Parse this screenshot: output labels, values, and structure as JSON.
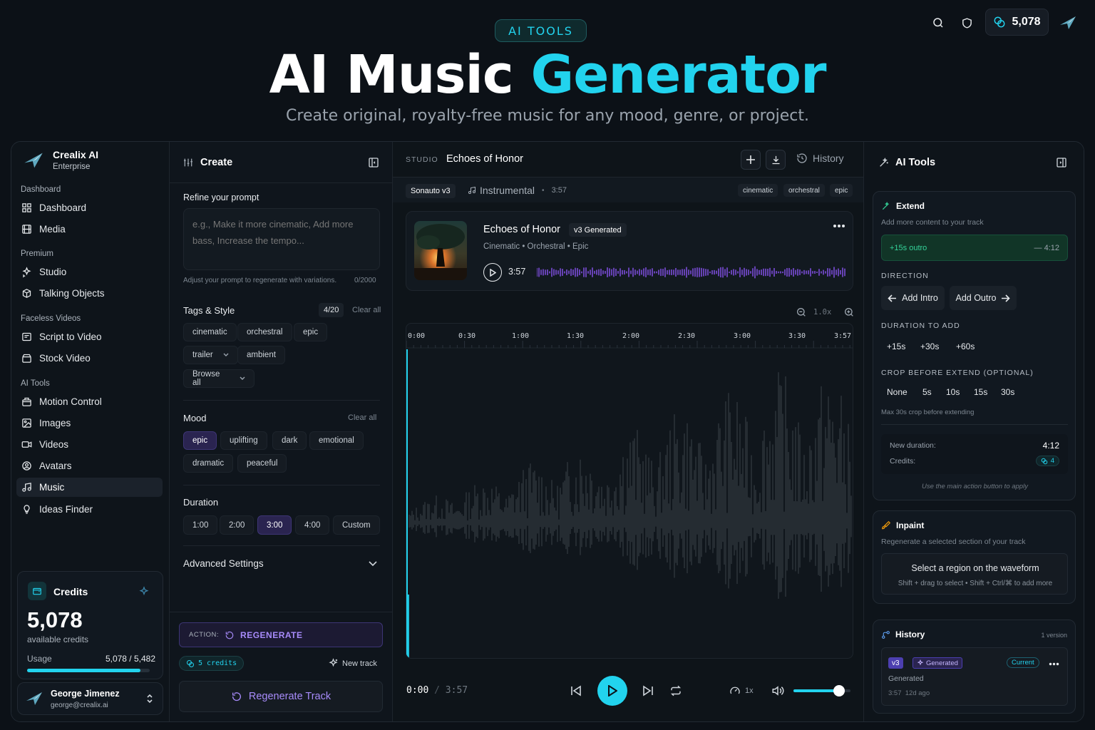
{
  "hero": {
    "badge": "AI TOOLS",
    "title_part1": "AI Music ",
    "title_part2": "Generator",
    "subtitle": "Create original, royalty-free music for any mood, genre, or project."
  },
  "topbar": {
    "credits": "5,078"
  },
  "sidebar": {
    "brand_name": "Crealix AI",
    "brand_plan": "Enterprise",
    "sections": [
      {
        "title": "Dashboard",
        "items": [
          "Dashboard",
          "Media"
        ]
      },
      {
        "title": "Premium",
        "items": [
          "Studio",
          "Talking Objects"
        ]
      },
      {
        "title": "Faceless Videos",
        "items": [
          "Script to Video",
          "Stock Video"
        ]
      },
      {
        "title": "AI Tools",
        "items": [
          "Motion Control",
          "Images",
          "Videos",
          "Avatars",
          "Music",
          "Ideas Finder"
        ]
      }
    ],
    "credits": {
      "title": "Credits",
      "value": "5,078",
      "sub": "available credits",
      "usage_label": "Usage",
      "usage_value": "5,078 / 5,482",
      "usage_fraction": 0.926
    },
    "user": {
      "name": "George Jimenez",
      "email": "george@crealix.ai"
    }
  },
  "create": {
    "title": "Create",
    "refine_label": "Refine your prompt",
    "prompt_placeholder": "e.g., Make it more cinematic, Add more bass, Increase the tempo...",
    "prompt_hint": "Adjust your prompt to regenerate with variations.",
    "prompt_count": "0/2000",
    "tags_label": "Tags & Style",
    "tags_count": "4/20",
    "tags_clear": "Clear all",
    "tags": [
      "cinematic",
      "orchestral",
      "epic",
      "trailer",
      "ambient"
    ],
    "browse_all": "Browse all",
    "mood_label": "Mood",
    "mood_clear": "Clear all",
    "moods": [
      "epic",
      "uplifting",
      "dark",
      "emotional",
      "dramatic",
      "peaceful"
    ],
    "duration_label": "Duration",
    "durations": [
      "1:00",
      "2:00",
      "3:00",
      "4:00",
      "Custom"
    ],
    "advanced": "Advanced Settings",
    "action_prefix": "ACTION:",
    "action_name": "REGENERATE",
    "credits_chip": "5 credits",
    "new_track": "New track",
    "regenerate_button": "Regenerate Track"
  },
  "studio": {
    "label": "STUDIO",
    "title": "Echoes of Honor",
    "history": "History",
    "model": "Sonauto v3",
    "type": "Instrumental",
    "length": "3:57",
    "tags": [
      "cinematic",
      "orchestral",
      "epic"
    ],
    "track": {
      "title": "Echoes of Honor",
      "badge": "v3 Generated",
      "meta": "Cinematic • Orchestral • Epic",
      "duration": "3:57"
    },
    "zoom": "1.0x",
    "timeline": [
      "0:00",
      "0:30",
      "1:00",
      "1:30",
      "2:00",
      "2:30",
      "3:00",
      "3:30",
      "3:57"
    ],
    "player": {
      "current": "0:00",
      "sep": "/",
      "total": "3:57",
      "speed": "1x",
      "volume": 0.8
    }
  },
  "tools": {
    "title": "AI Tools",
    "extend": {
      "title": "Extend",
      "desc": "Add more content to your track",
      "bar_left": "+15s outro",
      "bar_right": "— 4:12",
      "direction_label": "DIRECTION",
      "add_intro": "Add Intro",
      "add_outro": "Add Outro",
      "duration_label": "DURATION TO ADD",
      "durations": [
        "+15s",
        "+30s",
        "+60s"
      ],
      "crop_label": "CROP BEFORE EXTEND (OPTIONAL)",
      "crops": [
        "None",
        "5s",
        "10s",
        "15s",
        "30s"
      ],
      "crop_hint": "Max 30s crop before extending",
      "new_duration_label": "New duration:",
      "new_duration": "4:12",
      "credits_label": "Credits:",
      "credits_value": "4",
      "apply_hint": "Use the main action button to apply"
    },
    "inpaint": {
      "title": "Inpaint",
      "desc": "Regenerate a selected section of your track",
      "box_title": "Select a region on the waveform",
      "box_hint": "Shift + drag to select • Shift + Ctrl/⌘ to add more"
    },
    "history": {
      "title": "History",
      "count": "1 version",
      "version": "v3",
      "generated_badge": "Generated",
      "current": "Current",
      "item_title": "Generated",
      "item_meta": "3:57  12d ago"
    }
  },
  "colors": {
    "accent": "#22d3ee",
    "purple": "#8b5cf6",
    "bg": "#0c1117"
  }
}
